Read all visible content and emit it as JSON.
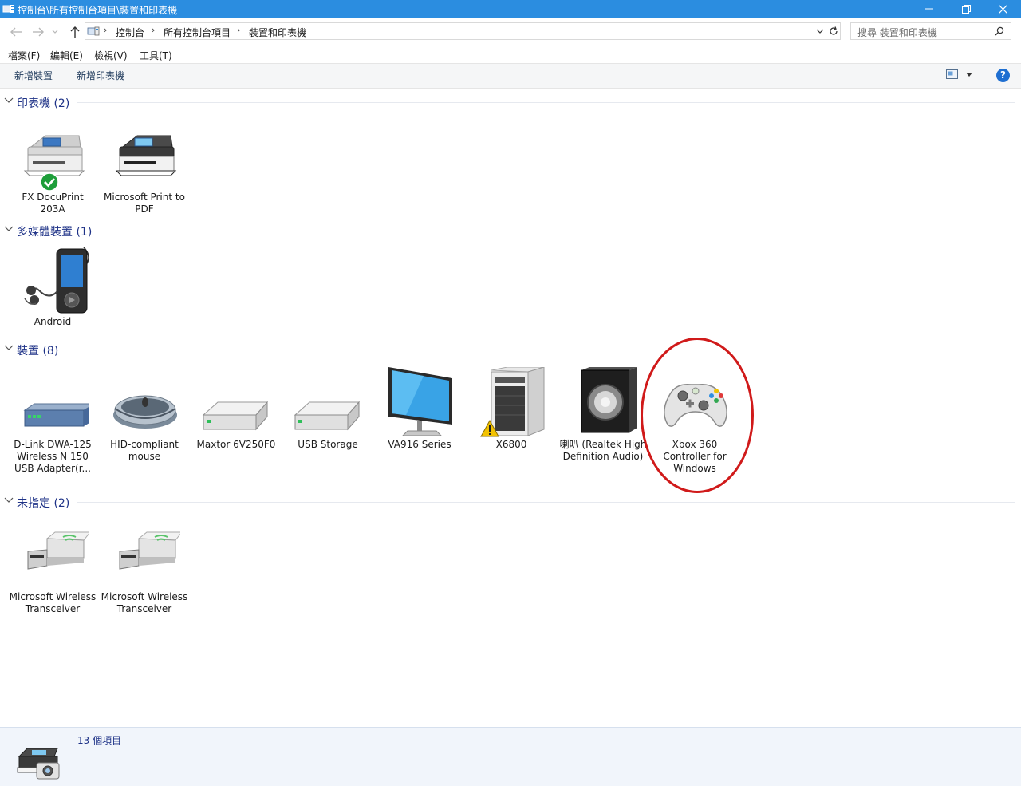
{
  "window": {
    "title": "控制台\\所有控制台項目\\裝置和印表機"
  },
  "address": {
    "crumbs": [
      "控制台",
      "所有控制台項目",
      "裝置和印表機"
    ],
    "search_placeholder": "搜尋 裝置和印表機"
  },
  "menu": {
    "file": "檔案(F)",
    "edit": "編輯(E)",
    "view": "檢視(V)",
    "tools": "工具(T)"
  },
  "commands": {
    "add_device": "新增裝置",
    "add_printer": "新增印表機",
    "help": "?"
  },
  "groups": {
    "printers": {
      "title": "印表機 (2)",
      "items": [
        {
          "label": "FX DocuPrint 203A",
          "status": "default"
        },
        {
          "label": "Microsoft Print to PDF"
        }
      ]
    },
    "multimedia": {
      "title": "多媒體裝置 (1)",
      "items": [
        {
          "label": "Android"
        }
      ]
    },
    "devices": {
      "title": "裝置 (8)",
      "items": [
        {
          "label": "D-Link DWA-125 Wireless N 150 USB Adapter(r..."
        },
        {
          "label": "HID-compliant mouse"
        },
        {
          "label": "Maxtor 6V250F0"
        },
        {
          "label": "USB Storage"
        },
        {
          "label": "VA916 Series"
        },
        {
          "label": "X6800",
          "status": "warning"
        },
        {
          "label": "喇叭 (Realtek High Definition Audio)"
        },
        {
          "label": "Xbox 360 Controller for Windows",
          "highlighted": true
        }
      ]
    },
    "unspecified": {
      "title": "未指定 (2)",
      "items": [
        {
          "label": "Microsoft Wireless Transceiver"
        },
        {
          "label": "Microsoft Wireless Transceiver"
        }
      ]
    }
  },
  "status": {
    "count": "13 個項目"
  },
  "colors": {
    "titlebar": "#2b8de0",
    "group_header_text": "#1e3287",
    "highlight_ring": "#d01a1a",
    "status_ok": "#1e9e3a",
    "status_warning": "#f2c200"
  }
}
